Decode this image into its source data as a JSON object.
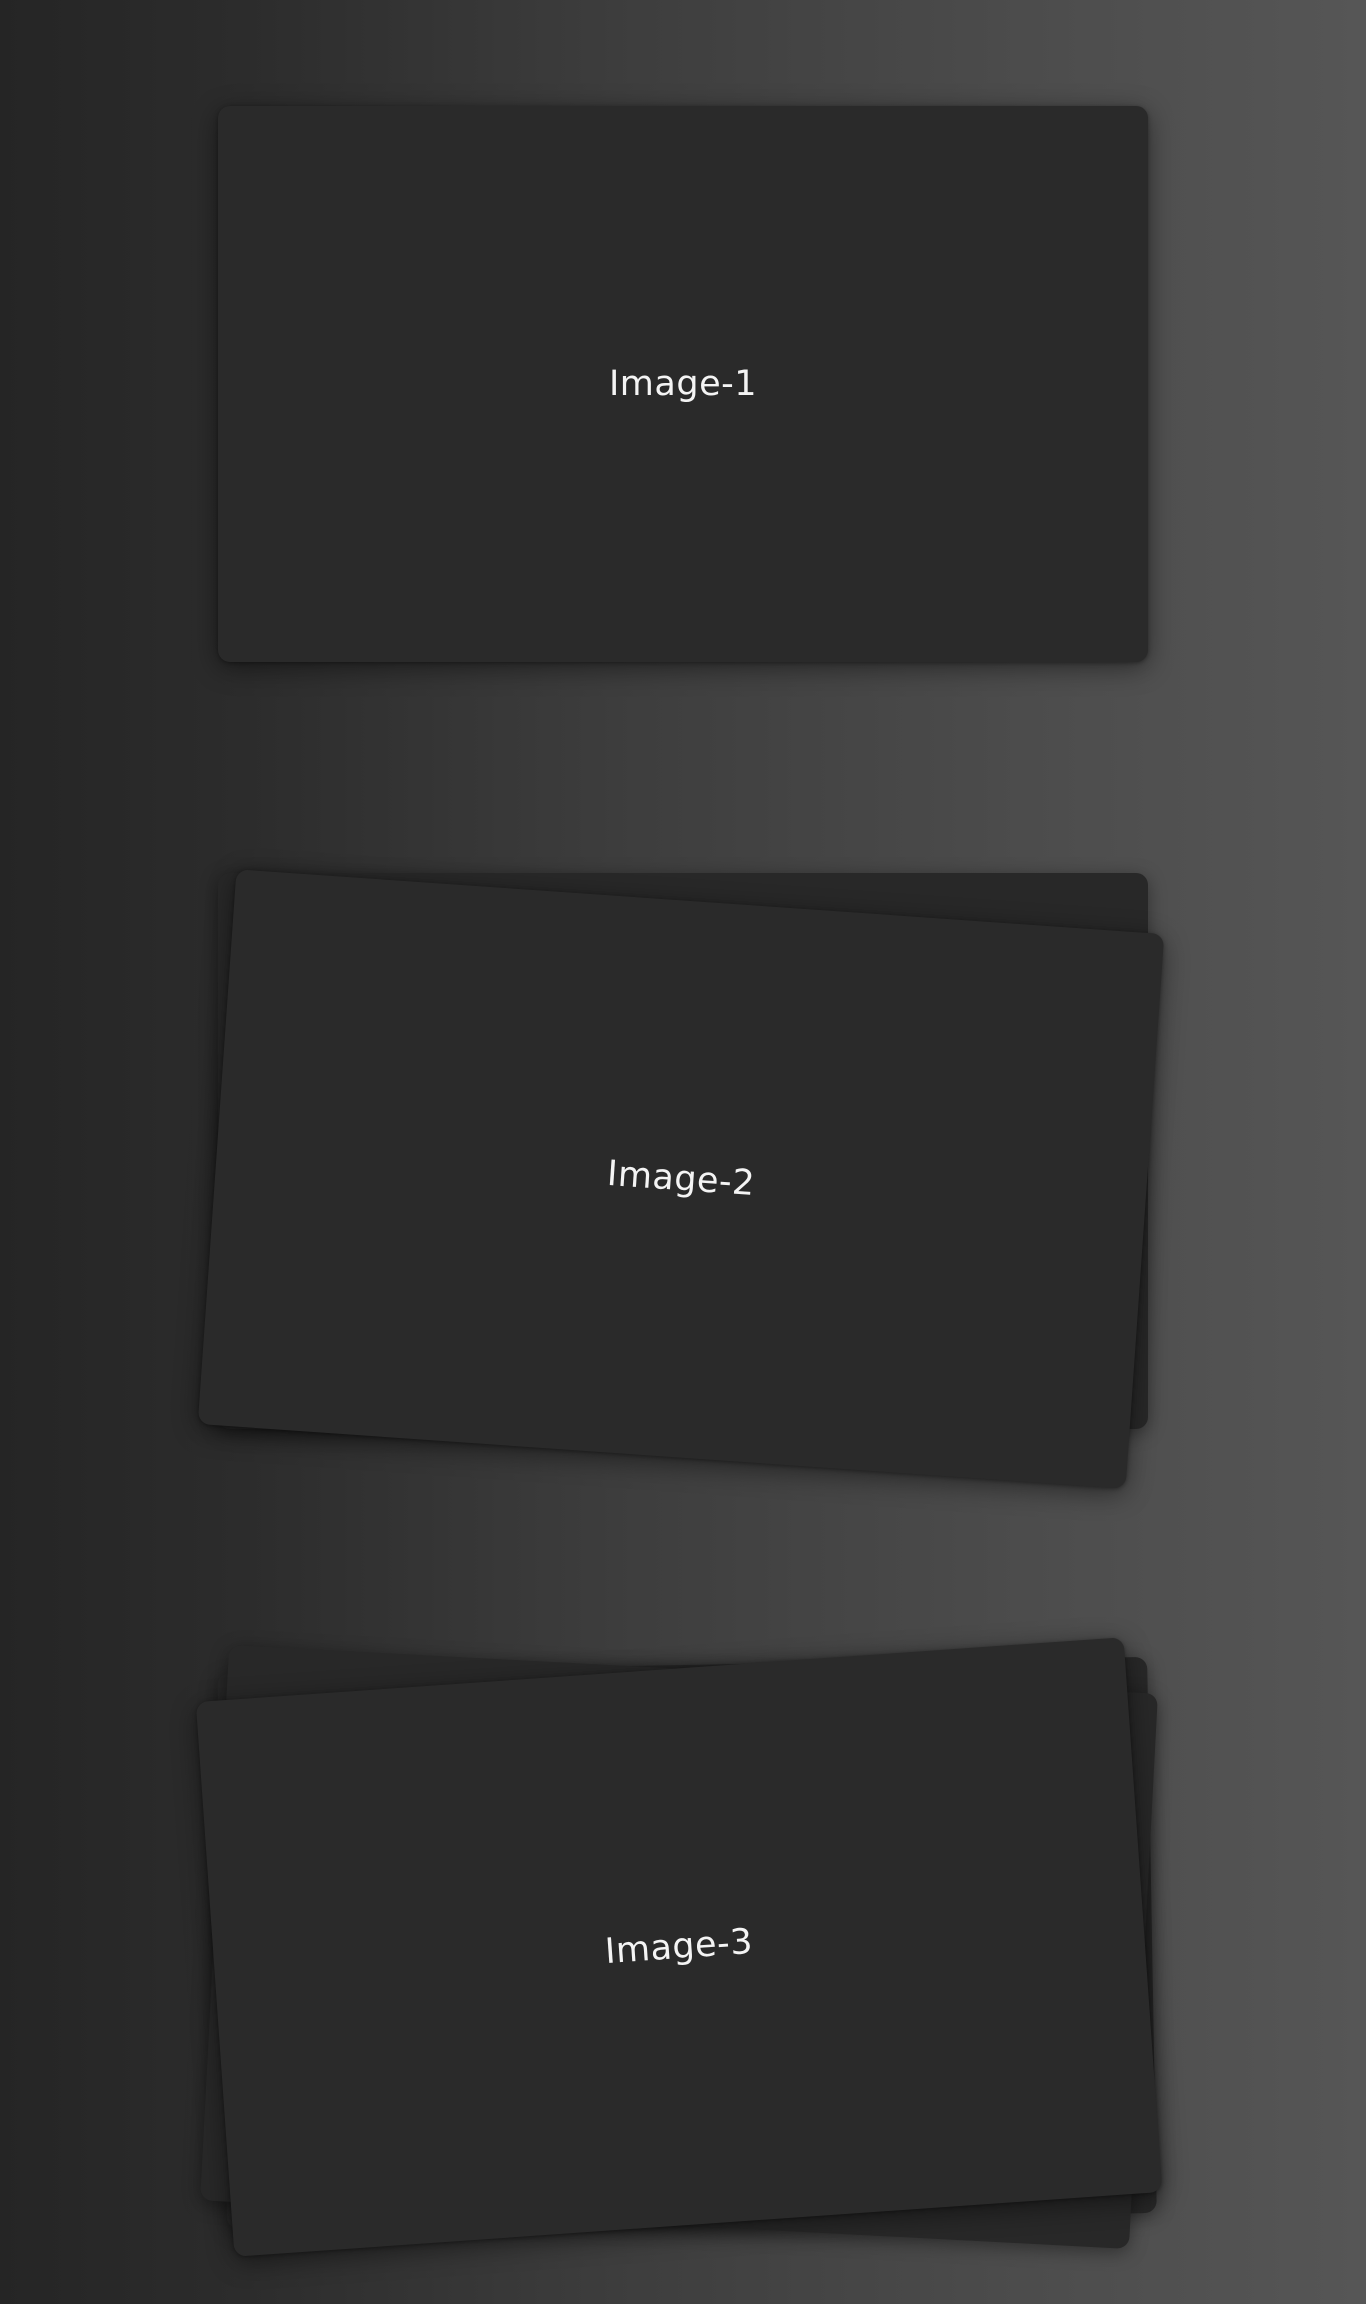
{
  "theme": {
    "card_color": "#2a2a2a",
    "label_color": "#f4f4f4",
    "background_left": "#252525",
    "background_right": "#565656"
  },
  "cards": [
    {
      "label": "Image-1"
    },
    {
      "label": "Image-2"
    },
    {
      "label": "Image-3"
    }
  ]
}
